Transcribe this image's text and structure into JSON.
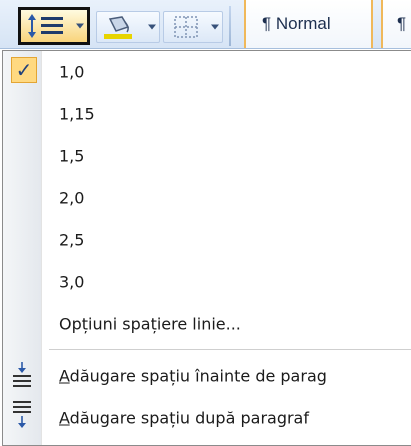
{
  "ribbon": {
    "line_spacing_button": {
      "icon": "line-spacing-icon"
    },
    "shading_button": {
      "icon": "paint-bucket-icon",
      "accent": "#e7d400"
    },
    "borders_button": {
      "icon": "borders-icon"
    },
    "styles": [
      {
        "label": "¶ Normal"
      },
      {
        "label": "¶"
      }
    ]
  },
  "menu": {
    "items": [
      {
        "label": "1,0",
        "checked": true
      },
      {
        "label": "1,15"
      },
      {
        "label": "1,5"
      },
      {
        "label": "2,0"
      },
      {
        "label": "2,5"
      },
      {
        "label": "3,0"
      },
      {
        "label": "Opțiuni spațiere linie..."
      },
      {
        "label_first": "A",
        "label_rest": "dăugare spațiu înainte de parag",
        "icon": "add-space-before-icon"
      },
      {
        "label_first": "A",
        "label_rest": "dăugare spațiu după paragraf",
        "icon": "add-space-after-icon"
      }
    ]
  },
  "colors": {
    "selected_highlight": "#ffd981",
    "ribbon_bg": "#dbe6f5"
  }
}
